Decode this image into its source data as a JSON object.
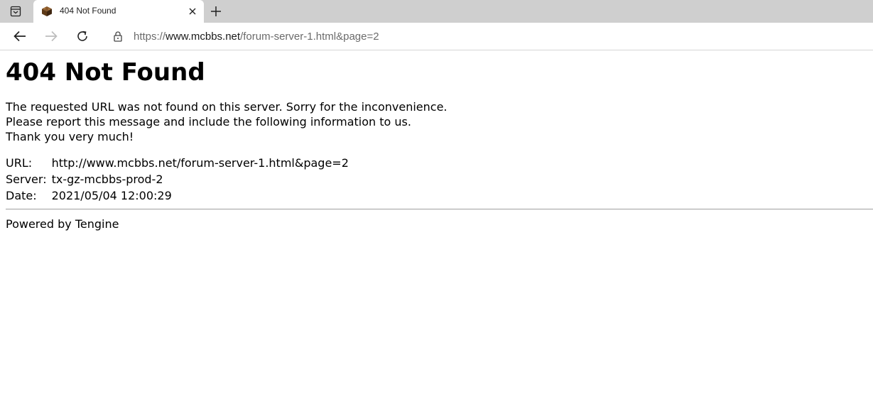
{
  "browser": {
    "tab": {
      "title": "404 Not Found",
      "favicon": "minecraft-block-icon"
    },
    "address_bar": {
      "scheme": "https://",
      "host": "www.mcbbs.net",
      "path": "/forum-server-1.html&page=2"
    },
    "icons": {
      "tab_actions": "tab-actions-icon",
      "close": "close-icon",
      "new_tab": "plus-icon",
      "back": "back-arrow-icon",
      "forward": "forward-arrow-icon",
      "refresh": "refresh-icon",
      "lock": "lock-icon"
    }
  },
  "page": {
    "heading": "404 Not Found",
    "message_lines": [
      "The requested URL was not found on this server. Sorry for the inconvenience.",
      "Please report this message and include the following information to us.",
      "Thank you very much!"
    ],
    "info": [
      {
        "key": "URL:",
        "value": "http://www.mcbbs.net/forum-server-1.html&page=2"
      },
      {
        "key": "Server:",
        "value": "tx-gz-mcbbs-prod-2"
      },
      {
        "key": "Date:",
        "value": "2021/05/04 12:00:29"
      }
    ],
    "footer": "Powered by Tengine"
  }
}
